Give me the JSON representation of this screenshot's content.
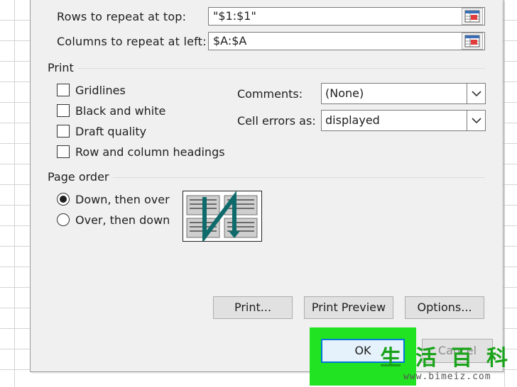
{
  "rows_repeat": {
    "label": "Rows to repeat at top:",
    "value": "\"$1:$1\""
  },
  "cols_repeat": {
    "label": "Columns to repeat at left:",
    "value": "$A:$A"
  },
  "print_group": {
    "title": "Print",
    "gridlines": {
      "label": "Gridlines",
      "checked": false
    },
    "black_white": {
      "label": "Black and white",
      "checked": false
    },
    "draft_quality": {
      "label": "Draft quality",
      "checked": false
    },
    "row_col_headings": {
      "label": "Row and column headings",
      "checked": false
    },
    "comments": {
      "label": "Comments:",
      "value": "(None)"
    },
    "cell_errors": {
      "label": "Cell errors as:",
      "value": "displayed"
    }
  },
  "page_order": {
    "title": "Page order",
    "down_then_over": {
      "label": "Down, then over",
      "selected": true
    },
    "over_then_down": {
      "label": "Over, then down",
      "selected": false
    }
  },
  "buttons": {
    "print": "Print...",
    "print_preview": "Print Preview",
    "options": "Options...",
    "ok": "OK",
    "cancel": "Cancel"
  },
  "watermark": {
    "chars": [
      "生",
      "活",
      "百",
      "科"
    ],
    "url": "www.bimeiz.com"
  },
  "colors": {
    "highlight": "#22e322",
    "ok_border": "#0078d7",
    "arrow": "#0f6b6b"
  }
}
